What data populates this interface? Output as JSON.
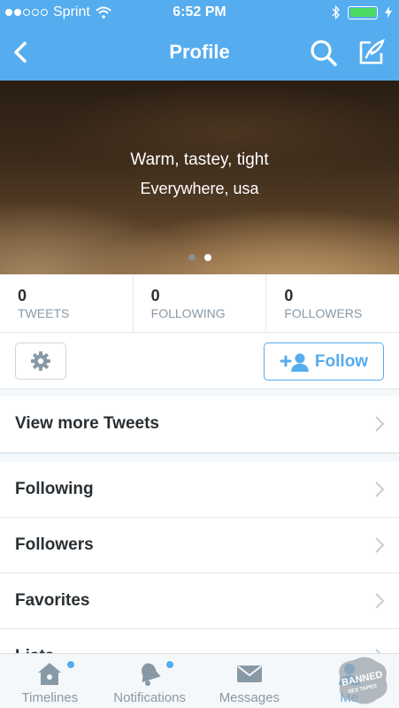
{
  "status_bar": {
    "carrier": "Sprint",
    "time": "6:52 PM",
    "signal_bars": 2,
    "battery_level": 1.0,
    "icons": [
      "signal-dots-icon",
      "wifi-icon",
      "bluetooth-icon",
      "battery-icon",
      "charging-bolt-icon"
    ]
  },
  "nav": {
    "title": "Profile",
    "icons": [
      "back-chevron-icon",
      "search-icon",
      "compose-icon"
    ]
  },
  "profile": {
    "name": "Warm, tastey, tight",
    "location": "Everywhere, usa",
    "pager_count": 2,
    "pager_active": 2
  },
  "stats": [
    {
      "value": "0",
      "label": "TWEETS"
    },
    {
      "value": "0",
      "label": "FOLLOWING"
    },
    {
      "value": "0",
      "label": "FOLLOWERS"
    }
  ],
  "actions": {
    "follow_label": "Follow",
    "icons": [
      "gear-icon",
      "add-user-icon"
    ]
  },
  "rows": {
    "view_more": "View more Tweets",
    "following": "Following",
    "followers": "Followers",
    "favorites": "Favorites",
    "lists": "Lists"
  },
  "tabbar": {
    "tabs": [
      {
        "label": "Timelines",
        "icon": "home-icon",
        "badge": true
      },
      {
        "label": "Notifications",
        "icon": "bell-icon",
        "badge": true
      },
      {
        "label": "Messages",
        "icon": "envelope-icon",
        "badge": false
      },
      {
        "label": "Me",
        "icon": "person-icon",
        "badge": false,
        "active": true
      }
    ]
  },
  "watermark": {
    "text": "BANNED SEX TAPES"
  },
  "colors": {
    "accent": "#55acee",
    "text_dark": "#292f33",
    "text_muted": "#8899a6",
    "separator": "#e1e8ed"
  }
}
